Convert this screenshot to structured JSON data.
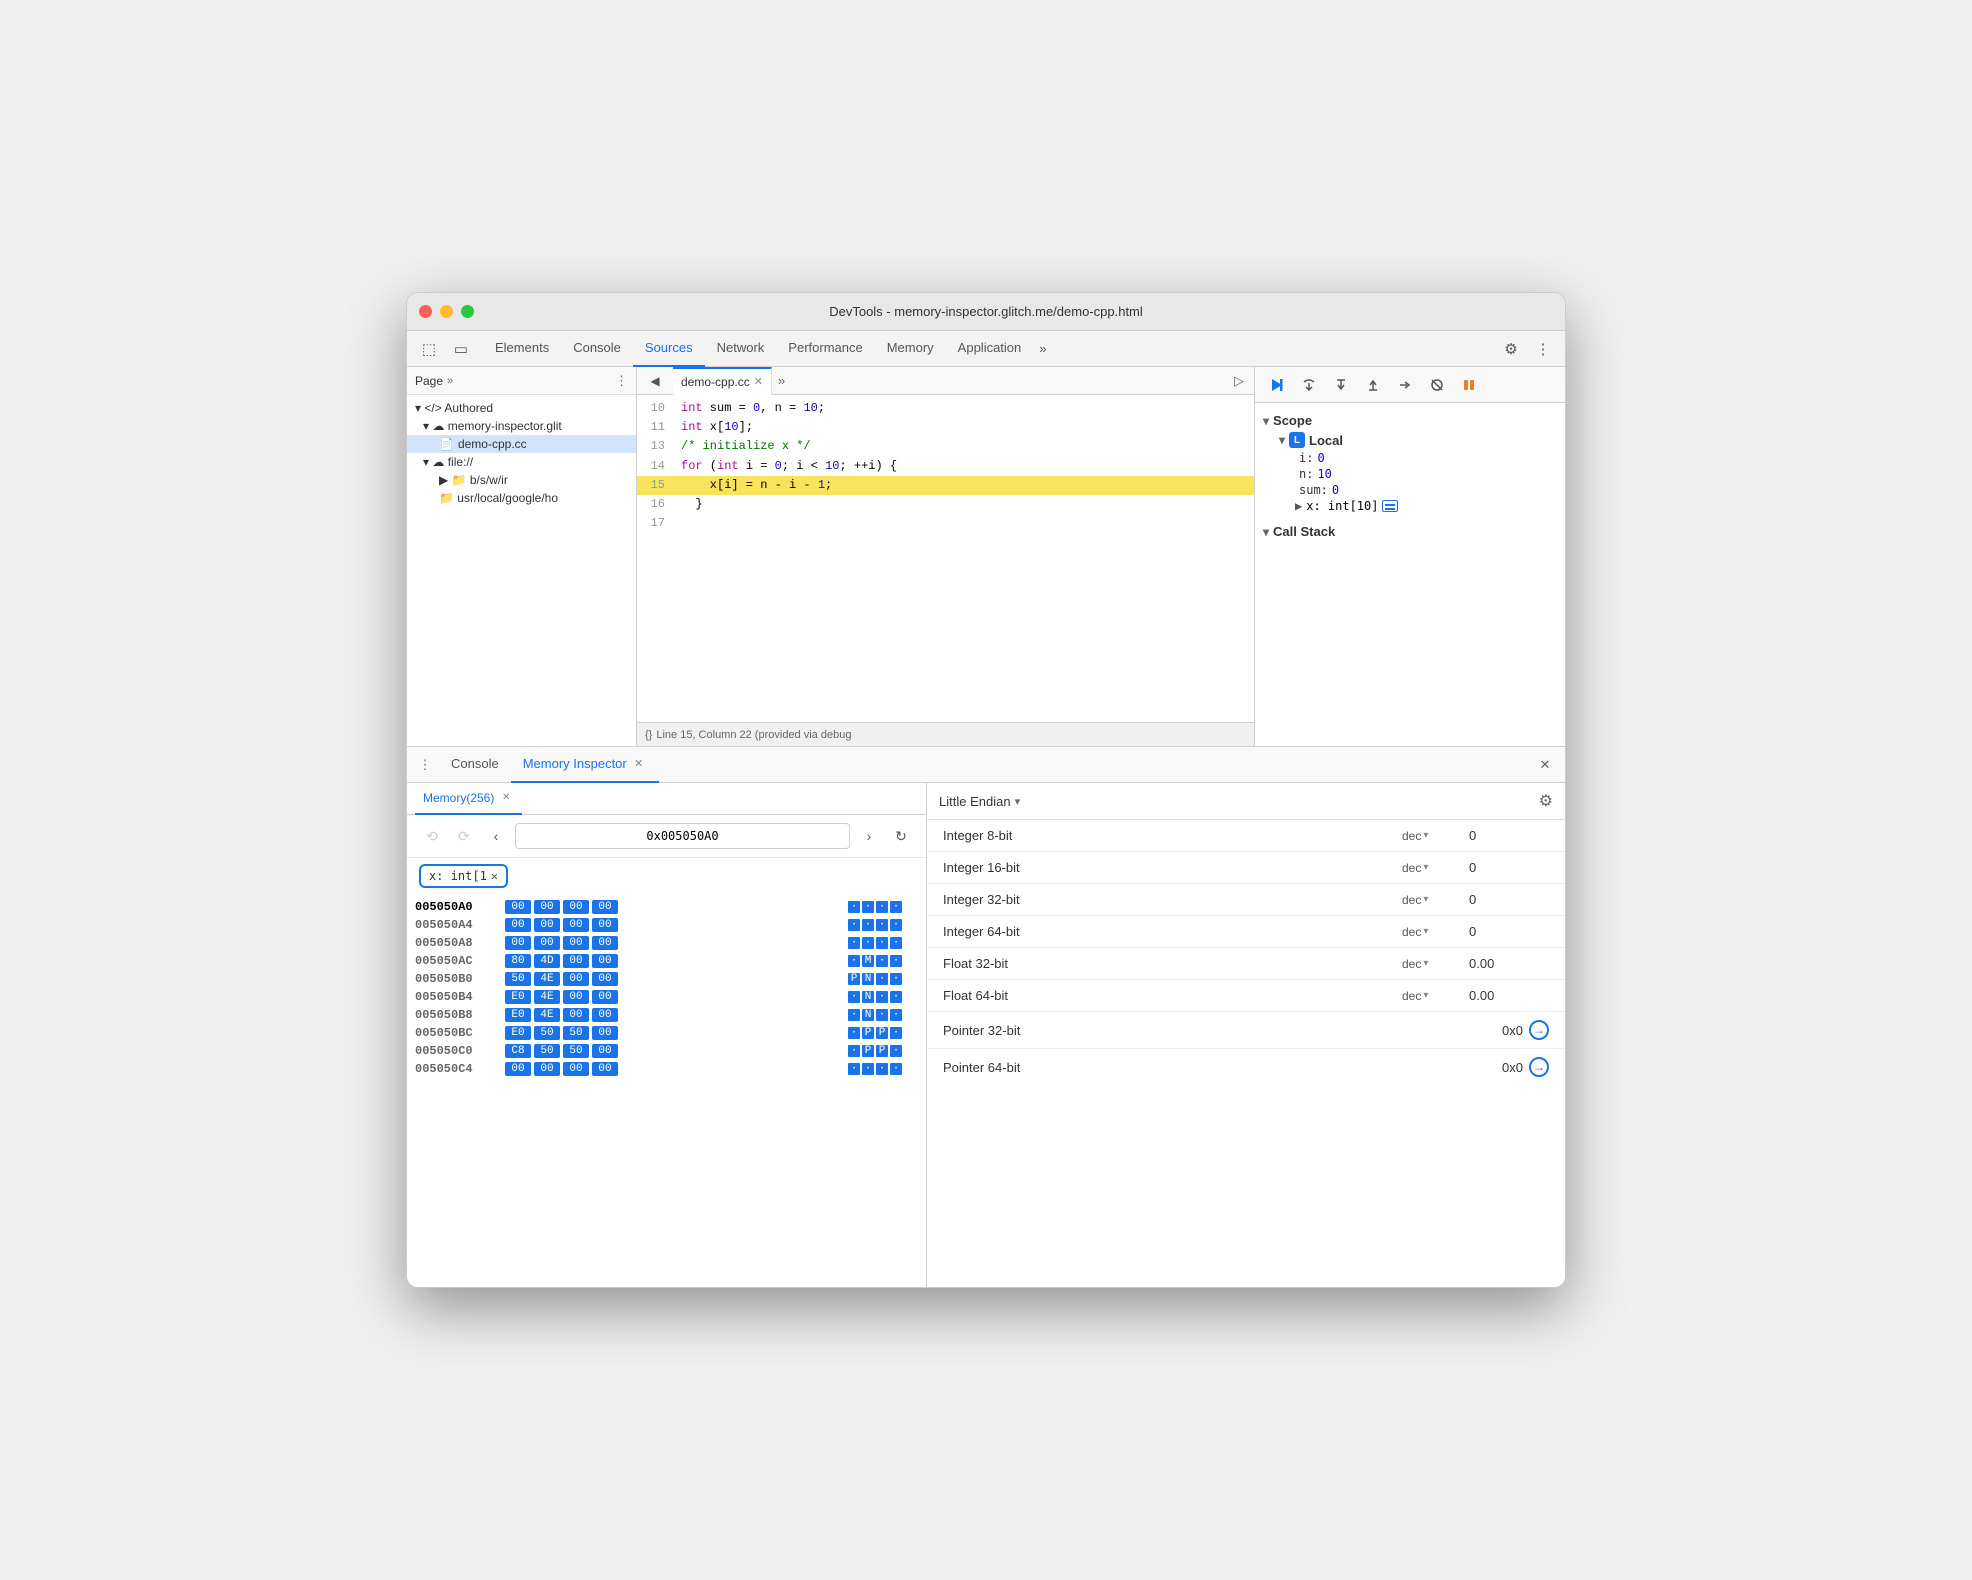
{
  "window": {
    "title": "DevTools - memory-inspector.glitch.me/demo-cpp.html"
  },
  "titlebar_buttons": {
    "close": "●",
    "minimize": "●",
    "maximize": "●"
  },
  "devtools_tabs": {
    "items": [
      {
        "label": "Elements",
        "active": false
      },
      {
        "label": "Console",
        "active": false
      },
      {
        "label": "Sources",
        "active": true
      },
      {
        "label": "Network",
        "active": false
      },
      {
        "label": "Performance",
        "active": false
      },
      {
        "label": "Memory",
        "active": false
      },
      {
        "label": "Application",
        "active": false
      }
    ],
    "more_label": "»"
  },
  "file_tree": {
    "panel_title": "Page",
    "items": [
      {
        "label": "▾ </> Authored",
        "indent": 0
      },
      {
        "label": "▾ ☁ memory-inspector.glit",
        "indent": 1
      },
      {
        "label": "demo-cpp.cc",
        "indent": 2,
        "active": true
      },
      {
        "label": "▾ ☁ file://",
        "indent": 1
      },
      {
        "label": "▶ 📁 b/s/w/ir",
        "indent": 2
      },
      {
        "label": "📁 usr/local/google/ho",
        "indent": 2
      }
    ]
  },
  "source_file": {
    "tab_name": "demo-cpp.cc",
    "lines": [
      {
        "num": "10",
        "content": "  int sum = 0, n = 10;",
        "highlighted": false
      },
      {
        "num": "11",
        "content": "  int x[10];",
        "highlighted": false
      },
      {
        "num": "13",
        "content": "  /* initialize x */",
        "highlighted": false
      },
      {
        "num": "14",
        "content": "  for (int i = 0; i < 10; ++i) {",
        "highlighted": false
      },
      {
        "num": "15",
        "content": "    x[i] = n - i - 1;",
        "highlighted": true
      },
      {
        "num": "16",
        "content": "  }",
        "highlighted": false
      },
      {
        "num": "17",
        "content": "",
        "highlighted": false
      }
    ],
    "status": "Line 15, Column 22 (provided via debug"
  },
  "debug_toolbar": {
    "buttons": [
      {
        "icon": "▶",
        "label": "resume",
        "active": true
      },
      {
        "icon": "↺",
        "label": "step-over"
      },
      {
        "icon": "↓",
        "label": "step-into"
      },
      {
        "icon": "↑",
        "label": "step-out"
      },
      {
        "icon": "→|",
        "label": "step"
      },
      {
        "icon": "✎",
        "label": "deactivate"
      },
      {
        "icon": "⏸",
        "label": "pause-on-exceptions"
      }
    ]
  },
  "scope": {
    "title": "Scope",
    "local_section": {
      "label": "Local",
      "badge": "L",
      "vars": [
        {
          "name": "i:",
          "value": "0"
        },
        {
          "name": "n:",
          "value": "10"
        },
        {
          "name": "sum:",
          "value": "0"
        }
      ],
      "special": {
        "name": "x:",
        "type": "int[10]",
        "has_memory_icon": true
      }
    },
    "call_stack_title": "Call Stack"
  },
  "bottom_panel": {
    "tabs": [
      {
        "label": "Console",
        "active": false,
        "closable": false
      },
      {
        "label": "Memory Inspector",
        "active": true,
        "closable": true
      }
    ]
  },
  "memory_sub_tabs": {
    "items": [
      {
        "label": "Memory(256)",
        "active": true,
        "closable": true
      }
    ]
  },
  "memory_toolbar": {
    "back_label": "⟲",
    "forward_label": "⟳",
    "prev_label": "‹",
    "address": "0x005050A0",
    "next_label": "›",
    "refresh_label": "↻"
  },
  "memory_tag": {
    "label": "x: int[1",
    "close": "✕"
  },
  "hex_rows": [
    {
      "addr": "005050A0",
      "current": true,
      "bytes": [
        "00",
        "00",
        "00",
        "00"
      ],
      "ascii": [
        "·",
        "·",
        "·",
        "·"
      ]
    },
    {
      "addr": "005050A4",
      "current": false,
      "bytes": [
        "00",
        "00",
        "00",
        "00"
      ],
      "ascii": [
        "·",
        "·",
        "·",
        "·"
      ]
    },
    {
      "addr": "005050A8",
      "current": false,
      "bytes": [
        "00",
        "00",
        "00",
        "00"
      ],
      "ascii": [
        "·",
        "·",
        "·",
        "·"
      ]
    },
    {
      "addr": "005050AC",
      "current": false,
      "bytes": [
        "80",
        "4D",
        "00",
        "00"
      ],
      "ascii": [
        "·",
        "M",
        "·",
        "·"
      ]
    },
    {
      "addr": "005050B0",
      "current": false,
      "bytes": [
        "50",
        "4E",
        "00",
        "00"
      ],
      "ascii": [
        "P",
        "N",
        "·",
        "·"
      ]
    },
    {
      "addr": "005050B4",
      "current": false,
      "bytes": [
        "E0",
        "4E",
        "00",
        "00"
      ],
      "ascii": [
        "·",
        "N",
        "·",
        "·"
      ]
    },
    {
      "addr": "005050B8",
      "current": false,
      "bytes": [
        "E0",
        "4E",
        "00",
        "00"
      ],
      "ascii": [
        "·",
        "N",
        "·",
        "·"
      ]
    },
    {
      "addr": "005050BC",
      "current": false,
      "bytes": [
        "E0",
        "50",
        "50",
        "00"
      ],
      "ascii": [
        "·",
        "P",
        "P",
        "·"
      ]
    },
    {
      "addr": "005050C0",
      "current": false,
      "bytes": [
        "C8",
        "50",
        "50",
        "00"
      ],
      "ascii": [
        "·",
        "P",
        "P",
        "·"
      ]
    },
    {
      "addr": "005050C4",
      "current": false,
      "bytes": [
        "00",
        "00",
        "00",
        "00"
      ],
      "ascii": [
        "·",
        "·",
        "·",
        "·"
      ]
    }
  ],
  "inspector": {
    "endian_label": "Little Endian",
    "rows": [
      {
        "type": "Integer 8-bit",
        "format": "dec",
        "value": "0",
        "is_pointer": false
      },
      {
        "type": "Integer 16-bit",
        "format": "dec",
        "value": "0",
        "is_pointer": false
      },
      {
        "type": "Integer 32-bit",
        "format": "dec",
        "value": "0",
        "is_pointer": false
      },
      {
        "type": "Integer 64-bit",
        "format": "dec",
        "value": "0",
        "is_pointer": false
      },
      {
        "type": "Float 32-bit",
        "format": "dec",
        "value": "0.00",
        "is_pointer": false
      },
      {
        "type": "Float 64-bit",
        "format": "dec",
        "value": "0.00",
        "is_pointer": false
      },
      {
        "type": "Pointer 32-bit",
        "format": "",
        "value": "0x0",
        "is_pointer": true
      },
      {
        "type": "Pointer 64-bit",
        "format": "",
        "value": "0x0",
        "is_pointer": true
      }
    ]
  }
}
